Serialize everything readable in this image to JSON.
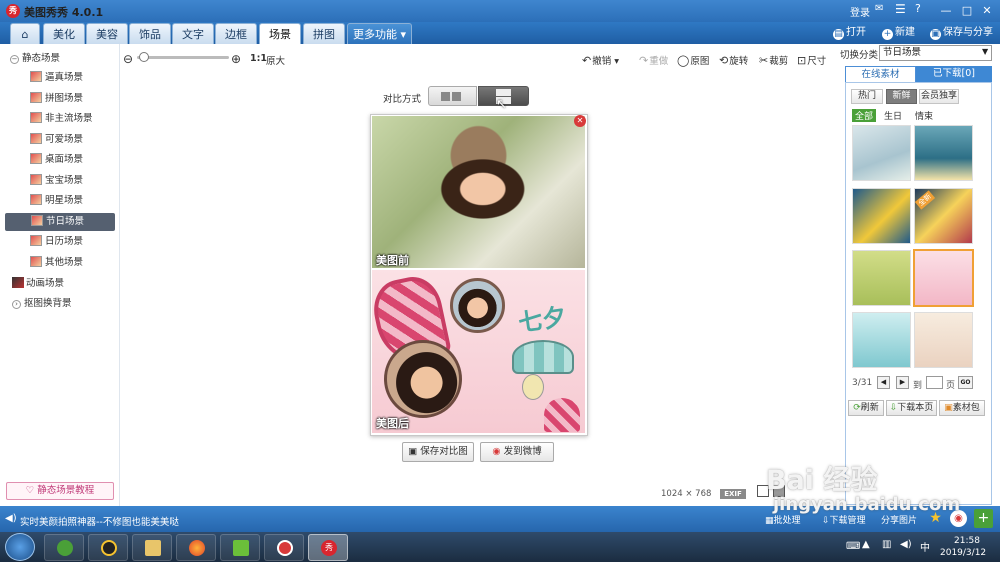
{
  "app": {
    "title": "美图秀秀 4.0.1",
    "logo_text": "秀"
  },
  "titlebar": {
    "login": "登录",
    "minimize": "—",
    "restore": "□",
    "close": "✕"
  },
  "tabs": [
    "美化",
    "美容",
    "饰品",
    "文字",
    "边框",
    "场景",
    "拼图"
  ],
  "active_tab": "场景",
  "more_tab": "更多功能",
  "top_actions": {
    "open": "打开",
    "new": "新建",
    "save_share": "保存与分享"
  },
  "sidebar": {
    "static_header": "静态场景",
    "items": [
      "逼真场景",
      "拼图场景",
      "非主流场景",
      "可爱场景",
      "桌面场景",
      "宝宝场景",
      "明星场景",
      "节日场景",
      "日历场景",
      "其他场景"
    ],
    "active_item": "节日场景",
    "animated": "动画场景",
    "cutout": "抠图换背景",
    "tutorial": "静态场景教程"
  },
  "toolbar": {
    "zoom_ratio": "1:1",
    "zoom_original": "原大",
    "undo": "撤销",
    "redo": "重做",
    "original": "原图",
    "rotate": "旋转",
    "crop": "裁剪",
    "resize": "尺寸"
  },
  "compare": {
    "label": "对比方式"
  },
  "canvas": {
    "before_label": "美图前",
    "after_label": "美图后",
    "qixi_text": "七夕"
  },
  "canvas_actions": {
    "save_compare": "保存对比图",
    "send_weibo": "发到微博"
  },
  "image_info": {
    "width": "1024",
    "times": "×",
    "height": "768",
    "exif": "EXIF"
  },
  "right_panel": {
    "category_label": "切换分类",
    "category_value": "节日场景",
    "tab_online": "在线素材",
    "tab_downloaded": "已下载[0]",
    "filters": [
      "热门",
      "新鲜",
      "会员独享"
    ],
    "active_filter": "新鲜",
    "subfilters": [
      "全部",
      "生日",
      "情束"
    ],
    "active_subfilter": "全部",
    "page_current": "3/31",
    "page_to": "到",
    "page_unit": "页",
    "page_go": "GO",
    "refresh": "刷新",
    "download_page": "下载本页",
    "material_pack": "素材包",
    "badge_new": "全新"
  },
  "statusbar": {
    "message": "实时美颜拍照神器--不修图也能美美哒",
    "batch": "批处理",
    "download_mgr": "下载管理",
    "share_image": "分享图片"
  },
  "taskbar": {
    "time": "21:58",
    "date": "2019/3/12"
  },
  "watermark": {
    "line1": "Bai 经验",
    "line2": "jingyan.baidu.com"
  },
  "colors": {
    "titlebar": "#2c6fb8",
    "accent_green": "#4aa038",
    "accent_orange": "#f0a035",
    "close_red": "#d83a3a"
  }
}
